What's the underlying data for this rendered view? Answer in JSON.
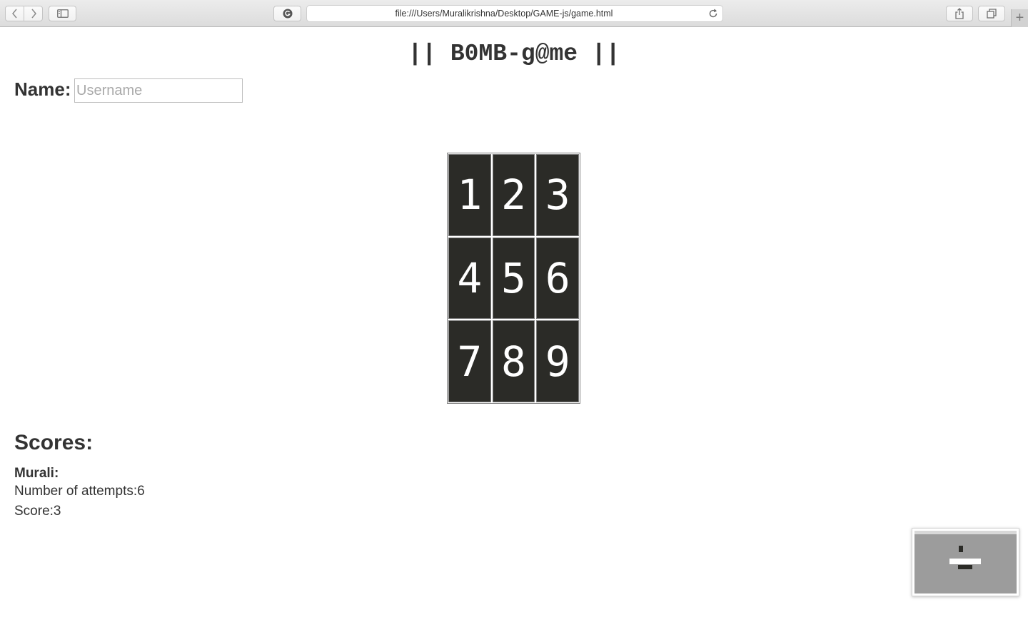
{
  "browser": {
    "url": "file:///Users/Muralikrishna/Desktop/GAME-js/game.html",
    "new_tab_label": "+"
  },
  "page": {
    "title": "|| B0MB-g@me ||",
    "name_label": "Name:",
    "name_placeholder": "Username",
    "name_value": ""
  },
  "grid": {
    "cells": [
      "1",
      "2",
      "3",
      "4",
      "5",
      "6",
      "7",
      "8",
      "9"
    ]
  },
  "scores": {
    "heading": "Scores:",
    "entries": [
      {
        "player": "Murali:",
        "attempts": "Number of attempts:6",
        "score": "Score:3"
      }
    ]
  },
  "colors": {
    "cell_background": "#2b2b27",
    "cell_text": "#ffffff",
    "page_text": "#333333"
  }
}
